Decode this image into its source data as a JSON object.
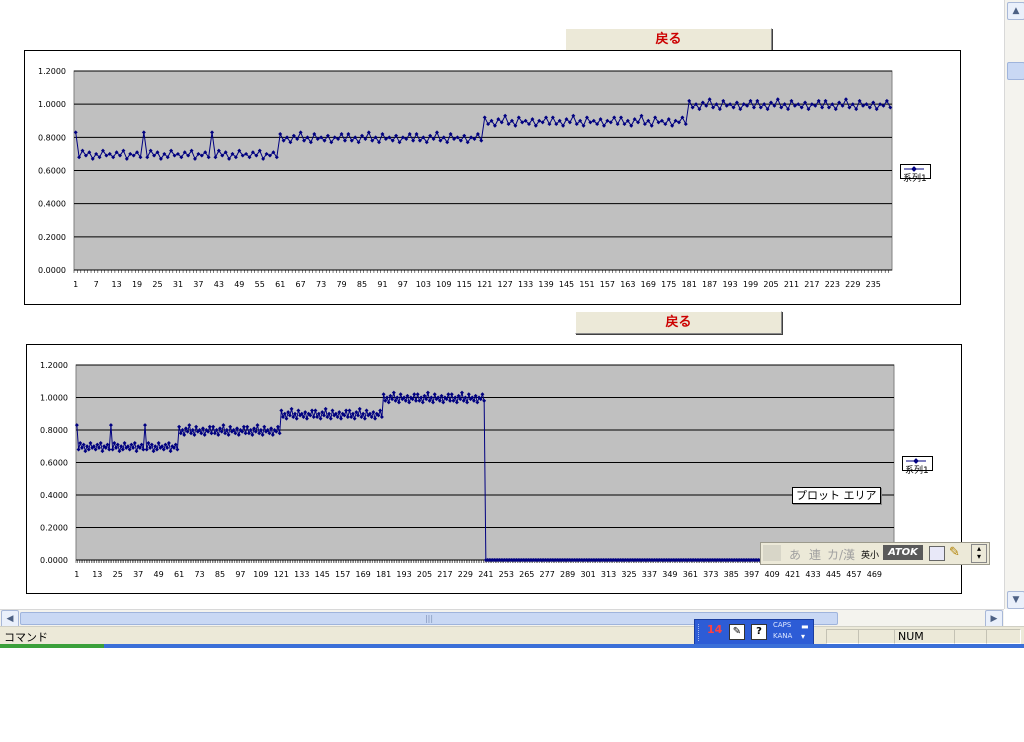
{
  "sheet": {
    "back_button_1": "戻る",
    "back_button_2": "戻る"
  },
  "tooltip": "プロット エリア",
  "status": {
    "text": "コマンド",
    "num": "NUM"
  },
  "ime": {
    "caps": "CAPS",
    "kana": "KANA",
    "num_icon": "14"
  },
  "atok": {
    "a": "あ",
    "ren": "連",
    "kanren": "カ/漢",
    "eisho": "英小",
    "logo": "ATOK"
  },
  "colors": {
    "plot_area": "#c0c0c0",
    "series": "#000080",
    "back_text": "#cc0000"
  },
  "chart_data": [
    {
      "type": "line",
      "title": "",
      "xlabel": "",
      "ylabel": "",
      "legend_position": "right",
      "ylim": [
        0,
        1.2
      ],
      "y_ticks": [
        "0.0000",
        "0.2000",
        "0.4000",
        "0.6000",
        "0.8000",
        "1.0000",
        "1.2000"
      ],
      "x_ticks": [
        "1",
        "7",
        "13",
        "19",
        "25",
        "31",
        "37",
        "43",
        "49",
        "55",
        "61",
        "67",
        "73",
        "79",
        "85",
        "91",
        "97",
        "103",
        "109",
        "115",
        "121",
        "127",
        "133",
        "139",
        "145",
        "151",
        "157",
        "163",
        "169",
        "175",
        "181",
        "187",
        "193",
        "199",
        "205",
        "211",
        "217",
        "223",
        "229",
        "235"
      ],
      "n_points": 240,
      "series": [
        {
          "name": "系列1",
          "values": [
            0.83,
            0.68,
            0.72,
            0.69,
            0.71,
            0.67,
            0.7,
            0.68,
            0.72,
            0.69,
            0.7,
            0.68,
            0.71,
            0.69,
            0.72,
            0.67,
            0.7,
            0.69,
            0.71,
            0.68,
            0.82,
            0.78,
            0.8,
            0.77,
            0.81,
            0.79,
            0.83,
            0.78,
            0.8,
            0.77,
            0.82,
            0.79,
            0.8,
            0.78,
            0.81,
            0.77,
            0.8,
            0.79,
            0.82,
            0.78,
            0.92,
            0.88,
            0.9,
            0.87,
            0.91,
            0.89,
            0.93,
            0.88,
            0.9,
            0.87,
            0.92,
            0.89,
            0.9,
            0.88,
            0.91,
            0.87,
            0.9,
            0.89,
            0.92,
            0.88,
            1.02,
            0.98,
            1.0,
            0.97,
            1.01,
            0.99,
            1.03,
            0.98,
            1.0,
            0.97,
            1.02,
            0.99,
            1.0,
            0.98,
            1.01,
            0.97,
            1.0,
            0.99,
            1.02,
            0.98
          ]
        }
      ]
    },
    {
      "type": "line",
      "title": "",
      "xlabel": "",
      "ylabel": "",
      "legend_position": "right",
      "ylim": [
        0,
        1.2
      ],
      "y_ticks": [
        "0.0000",
        "0.2000",
        "0.4000",
        "0.6000",
        "0.8000",
        "1.0000",
        "1.2000"
      ],
      "x_ticks": [
        "1",
        "13",
        "25",
        "37",
        "49",
        "61",
        "73",
        "85",
        "97",
        "109",
        "121",
        "133",
        "145",
        "157",
        "169",
        "181",
        "193",
        "205",
        "217",
        "229",
        "241",
        "253",
        "265",
        "277",
        "289",
        "301",
        "313",
        "325",
        "337",
        "349",
        "361",
        "373",
        "385",
        "397",
        "409",
        "421",
        "433",
        "445",
        "457",
        "469"
      ],
      "n_points": 480,
      "n_nonzero": 240,
      "series": [
        {
          "name": "系列1",
          "values": [
            0.83,
            0.68,
            0.72,
            0.69,
            0.71,
            0.67,
            0.7,
            0.68,
            0.72,
            0.69,
            0.7,
            0.68,
            0.71,
            0.69,
            0.72,
            0.67,
            0.7,
            0.69,
            0.71,
            0.68,
            0.82,
            0.78,
            0.8,
            0.77,
            0.81,
            0.79,
            0.83,
            0.78,
            0.8,
            0.77,
            0.82,
            0.79,
            0.8,
            0.78,
            0.81,
            0.77,
            0.8,
            0.79,
            0.82,
            0.78,
            0.92,
            0.88,
            0.9,
            0.87,
            0.91,
            0.89,
            0.93,
            0.88,
            0.9,
            0.87,
            0.92,
            0.89,
            0.9,
            0.88,
            0.91,
            0.87,
            0.9,
            0.89,
            0.92,
            0.88,
            1.02,
            0.98,
            1.0,
            0.97,
            1.01,
            0.99,
            1.03,
            0.98,
            1.0,
            0.97,
            1.02,
            0.99,
            1.0,
            0.98,
            1.01,
            0.97,
            1.0,
            0.99,
            1.02,
            0.98
          ]
        }
      ]
    }
  ]
}
